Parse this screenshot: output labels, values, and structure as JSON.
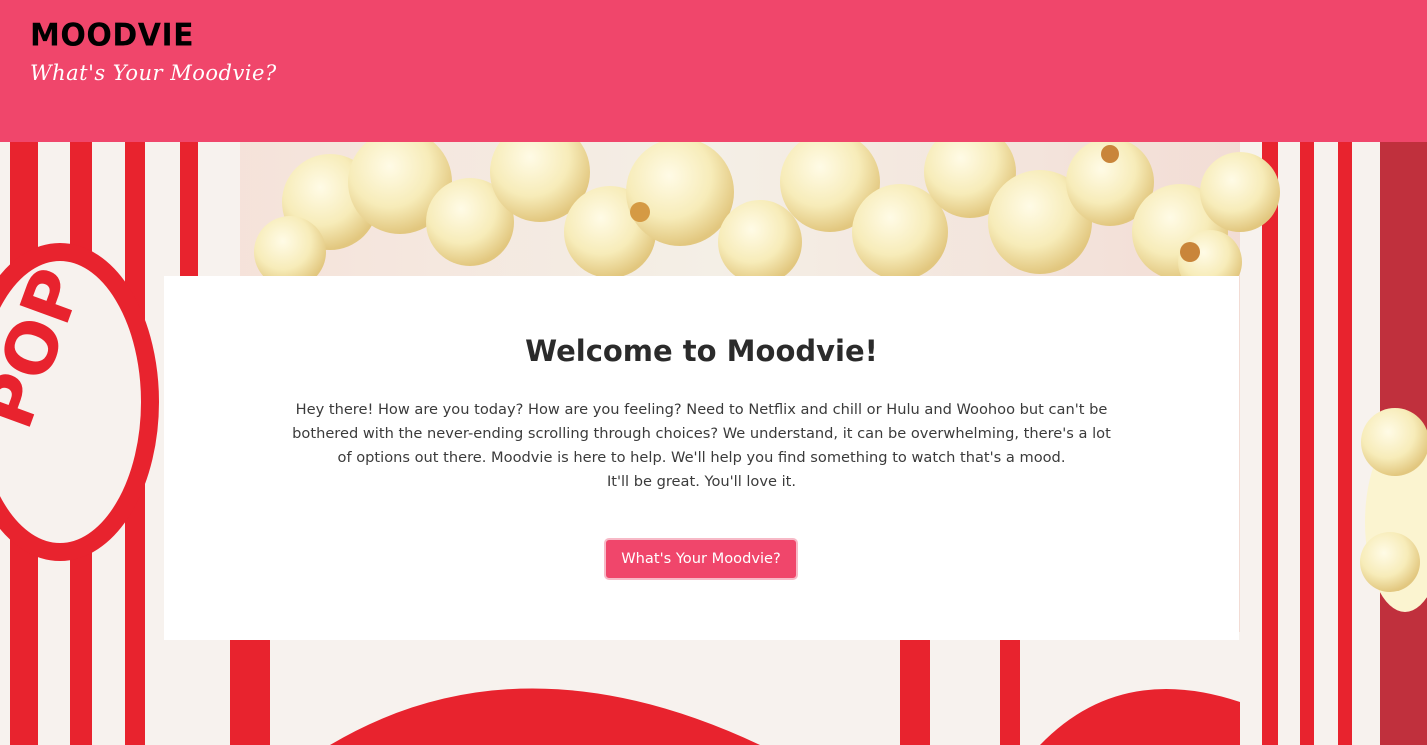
{
  "header": {
    "brand": "MOODVIE",
    "tagline": "What's Your Moodvie?"
  },
  "welcome": {
    "title": "Welcome to Moodvie!",
    "body_line1": "Hey there! How are you today? How are you feeling? Need to Netflix and chill or Hulu and Woohoo but can't be bothered with the never-ending scrolling through choices? We understand, it can be overwhelming, there's a lot of options out there. Moodvie is here to help. We'll help you find something to watch that's a mood.",
    "body_line2": "It'll be great. You'll love it.",
    "cta_label": "What's Your Moodvie?"
  },
  "hero_image": {
    "icon": "popcorn-background-image"
  },
  "colors": {
    "accent": "#f0466b",
    "button_border": "#f7b9c7",
    "card_bg": "#ffffff",
    "text": "#3b3b3b",
    "title": "#2b2b2b"
  }
}
